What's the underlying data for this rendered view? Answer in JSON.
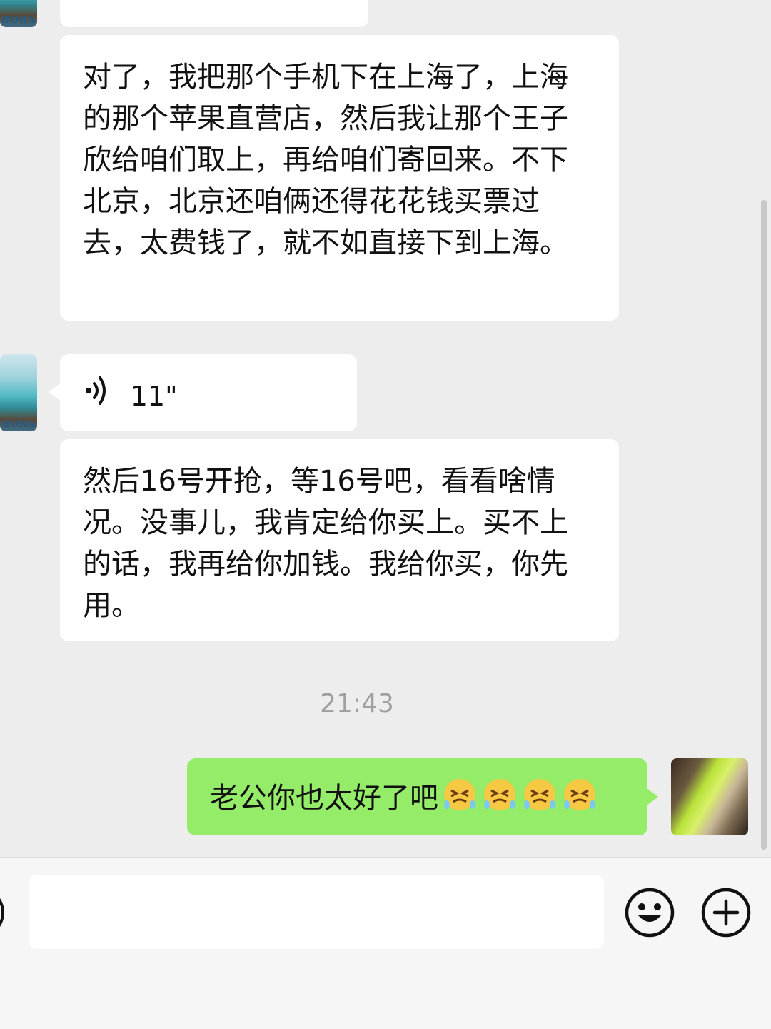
{
  "messages": [
    {
      "side": "left",
      "type": "text",
      "text": "对了，我把那个手机下在上海了，上海的那个苹果直营店，然后我让那个王子欣给咱们取上，再给咱们寄回来。不下北京，北京还咱俩还得花花钱买票过去，太费钱了，就不如直接下到上海。"
    },
    {
      "side": "left",
      "type": "voice",
      "duration": "11\""
    },
    {
      "side": "left",
      "type": "text",
      "text": "然后16号开抢，等16号吧，看看啥情况。没事儿，我肯定给你买上。买不上的话，我再给你加钱。我给你买，你先用。"
    },
    {
      "side": "right",
      "type": "text",
      "text": "老公你也太好了吧",
      "emoji_count": 4
    }
  ],
  "timestamp": "21:43",
  "avatar_left_label": "BORA",
  "colors": {
    "background": "#ededed",
    "bubble_left": "#ffffff",
    "bubble_right": "#95ec69",
    "timestamp": "#a0a0a0"
  },
  "icons": [
    "voice-icon",
    "emoji-smile-icon",
    "plus-circle-icon",
    "keyboard-voice-icon"
  ]
}
